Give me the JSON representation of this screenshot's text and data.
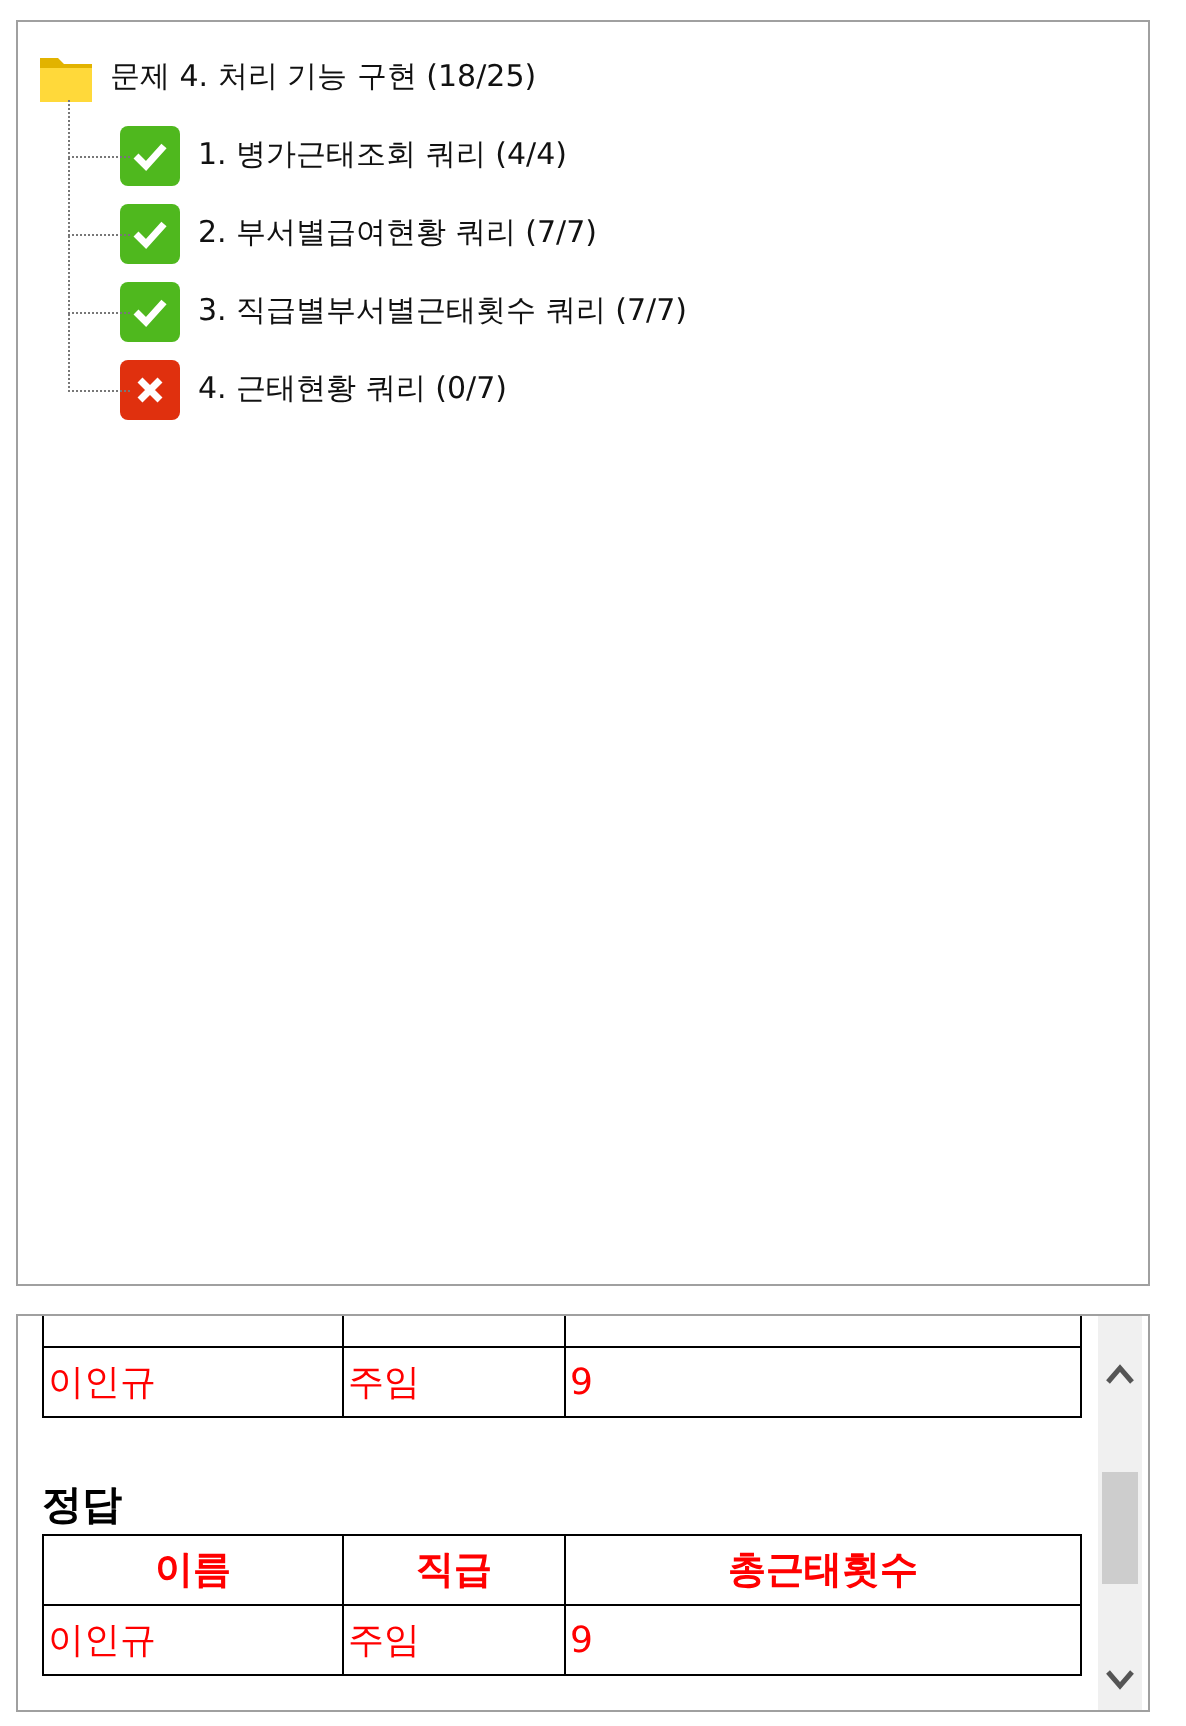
{
  "tree": {
    "label": "문제 4. 처리 기능 구현 (18/25)",
    "children": [
      {
        "label": "1. 병가근태조회 쿼리 (4/4)",
        "passed": true
      },
      {
        "label": "2. 부서별급여현황 쿼리 (7/7)",
        "passed": true
      },
      {
        "label": "3. 직급별부서별근태횟수 쿼리 (7/7)",
        "passed": true
      },
      {
        "label": "4. 근태현황 쿼리 (0/7)",
        "passed": false
      }
    ]
  },
  "result": {
    "rows": [
      [
        "이인규",
        "주임",
        "9"
      ]
    ]
  },
  "answer": {
    "title": "정답",
    "columns": [
      "이름",
      "직급",
      "총근태횟수"
    ],
    "rows": [
      [
        "이인규",
        "주임",
        "9"
      ]
    ]
  }
}
